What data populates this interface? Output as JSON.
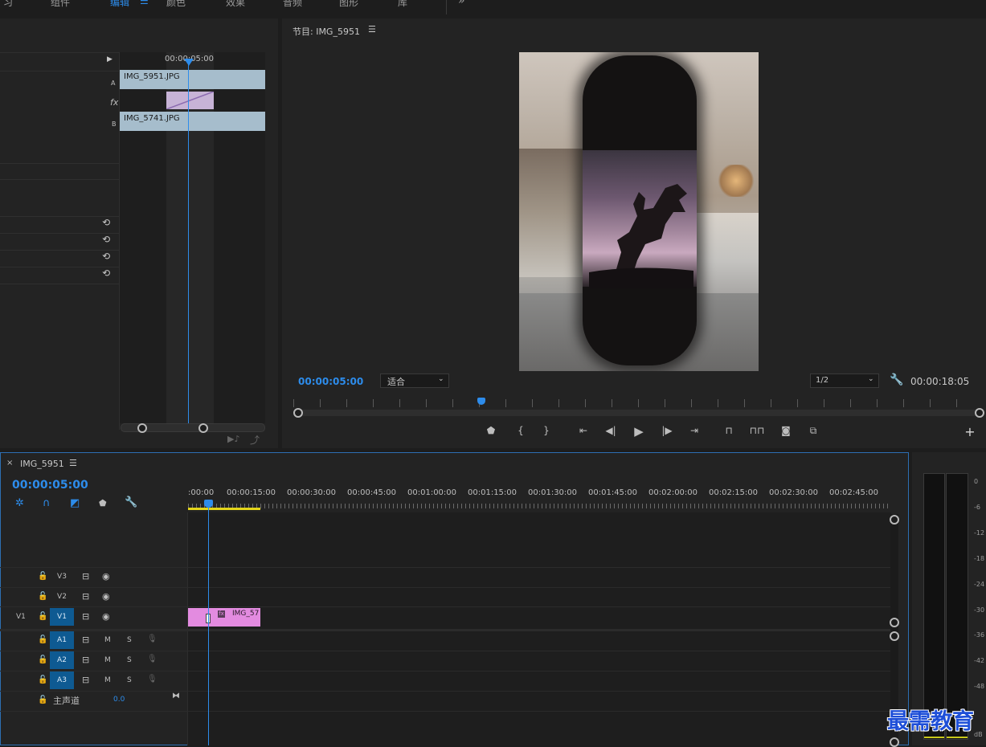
{
  "workspace_tabs": [
    {
      "label": "习",
      "active": false
    },
    {
      "label": "组件",
      "active": false
    },
    {
      "label": "编辑",
      "active": true
    },
    {
      "label": "颜色",
      "active": false
    },
    {
      "label": "效果",
      "active": false
    },
    {
      "label": "音频",
      "active": false
    },
    {
      "label": "图形",
      "active": false
    },
    {
      "label": "库",
      "active": false
    }
  ],
  "workspace_menu_icon": "hamburger-icon",
  "workspace_overflow": "»",
  "effect_controls": {
    "timecode": "00:00:05:00",
    "clip_a": "IMG_5951.JPG",
    "clip_b": "IMG_5741.JPG",
    "label_a": "A",
    "label_fx": "fx",
    "label_b": "B",
    "reset_icon": "reset-icon"
  },
  "program_monitor": {
    "title": "节目: IMG_5951",
    "current_time": "00:00:05:00",
    "zoom_value": "适合",
    "resolution_value": "1/2",
    "duration": "00:00:18:05"
  },
  "timeline": {
    "sequence_name": "IMG_5951",
    "close_glyph": "×",
    "current_time": "00:00:05:00",
    "ruler_labels": [
      ":00:00",
      "00:00:15:00",
      "00:00:30:00",
      "00:00:45:00",
      "00:01:00:00",
      "00:01:15:00",
      "00:01:30:00",
      "00:01:45:00",
      "00:02:00:00",
      "00:02:15:00",
      "00:02:30:00",
      "00:02:45:00"
    ],
    "video_tracks": [
      {
        "name": "V3",
        "source": "",
        "active": false
      },
      {
        "name": "V2",
        "source": "",
        "active": false
      },
      {
        "name": "V1",
        "source": "V1",
        "active": true
      }
    ],
    "audio_tracks": [
      {
        "name": "A1",
        "m": "M",
        "s": "S"
      },
      {
        "name": "A2",
        "m": "M",
        "s": "S"
      },
      {
        "name": "A3",
        "m": "M",
        "s": "S"
      }
    ],
    "master": {
      "label": "主声道",
      "value": "0.0"
    },
    "clip_label": "IMG_57",
    "clip_fx": "fx"
  },
  "audio_meter": {
    "ticks": [
      "0",
      "-6",
      "-12",
      "-18",
      "-24",
      "-30",
      "-36",
      "-42",
      "-48",
      "dB"
    ]
  },
  "watermark": "最需教育",
  "colors": {
    "accent": "#2d8ceb",
    "clip_video": "#e38be0",
    "clip_ec": "#a6bdcc",
    "track_active": "#0e5a92"
  }
}
